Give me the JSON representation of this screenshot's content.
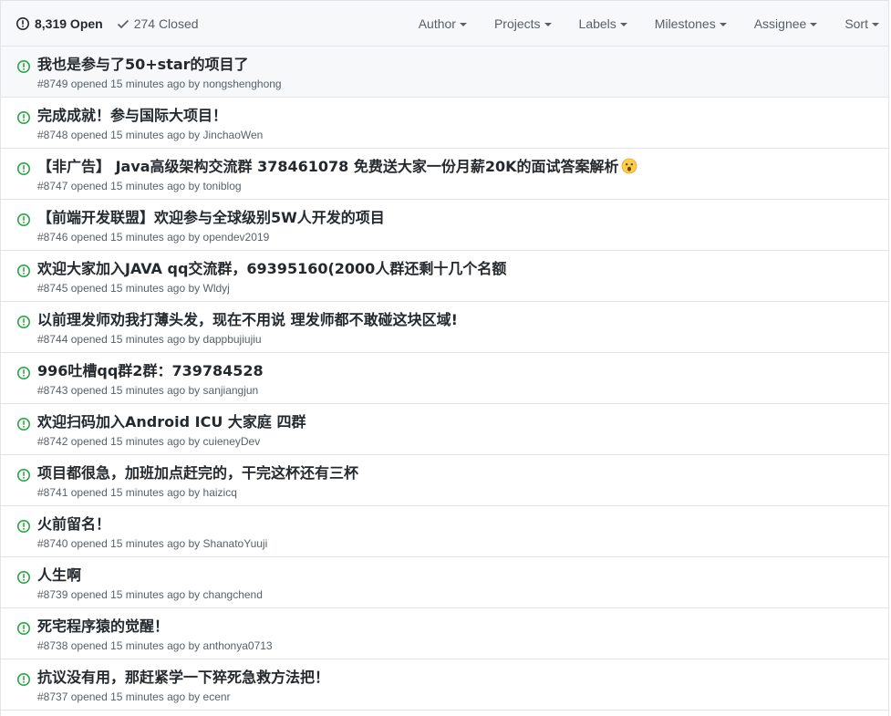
{
  "header": {
    "open_count": "8,319 Open",
    "closed_count": "274 Closed",
    "filters": [
      {
        "label": "Author"
      },
      {
        "label": "Projects"
      },
      {
        "label": "Labels"
      },
      {
        "label": "Milestones"
      },
      {
        "label": "Assignee"
      },
      {
        "label": "Sort"
      }
    ]
  },
  "opened_text": "opened 15 minutes ago by",
  "issues": [
    {
      "title": "我也是参与了50+star的项目了",
      "number": "#8749",
      "author": "nongshenghong"
    },
    {
      "title": "完成成就！参与国际大项目！",
      "number": "#8748",
      "author": "JinchaoWen"
    },
    {
      "title": "【非广告】 Java高级架构交流群 378461078 免费送大家一份月薪20K的面试答案解析",
      "number": "#8747",
      "author": "toniblog",
      "emoji": "astonished-face"
    },
    {
      "title": "【前端开发联盟】欢迎参与全球级别5W人开发的项目",
      "number": "#8746",
      "author": "opendev2019"
    },
    {
      "title": "欢迎大家加入JAVA qq交流群，69395160(2000人群还剩十几个名额",
      "number": "#8745",
      "author": "Wldyj"
    },
    {
      "title": "以前理发师劝我打薄头发，现在不用说 理发师都不敢碰这块区域!",
      "number": "#8744",
      "author": "dappbujiujiu"
    },
    {
      "title": "996吐槽qq群2群：739784528",
      "number": "#8743",
      "author": "sanjiangjun"
    },
    {
      "title": "欢迎扫码加入Android ICU 大家庭 四群",
      "number": "#8742",
      "author": "cuieneyDev"
    },
    {
      "title": "项目都很急，加班加点赶完的，干完这杯还有三杯",
      "number": "#8741",
      "author": "haizicq"
    },
    {
      "title": "火前留名！",
      "number": "#8740",
      "author": "ShanatoYuuji"
    },
    {
      "title": "人生啊",
      "number": "#8739",
      "author": "changchend"
    },
    {
      "title": "死宅程序猿的觉醒！",
      "number": "#8738",
      "author": "anthonya0713"
    },
    {
      "title": "抗议没有用，那赶紧学一下猝死急救方法把！",
      "number": "#8737",
      "author": "ecenr"
    }
  ],
  "colors": {
    "open_icon": "#28a745",
    "header_bg": "#f6f8fa",
    "border": "#e1e4e8",
    "muted_text": "#586069",
    "title_text": "#24292e"
  }
}
